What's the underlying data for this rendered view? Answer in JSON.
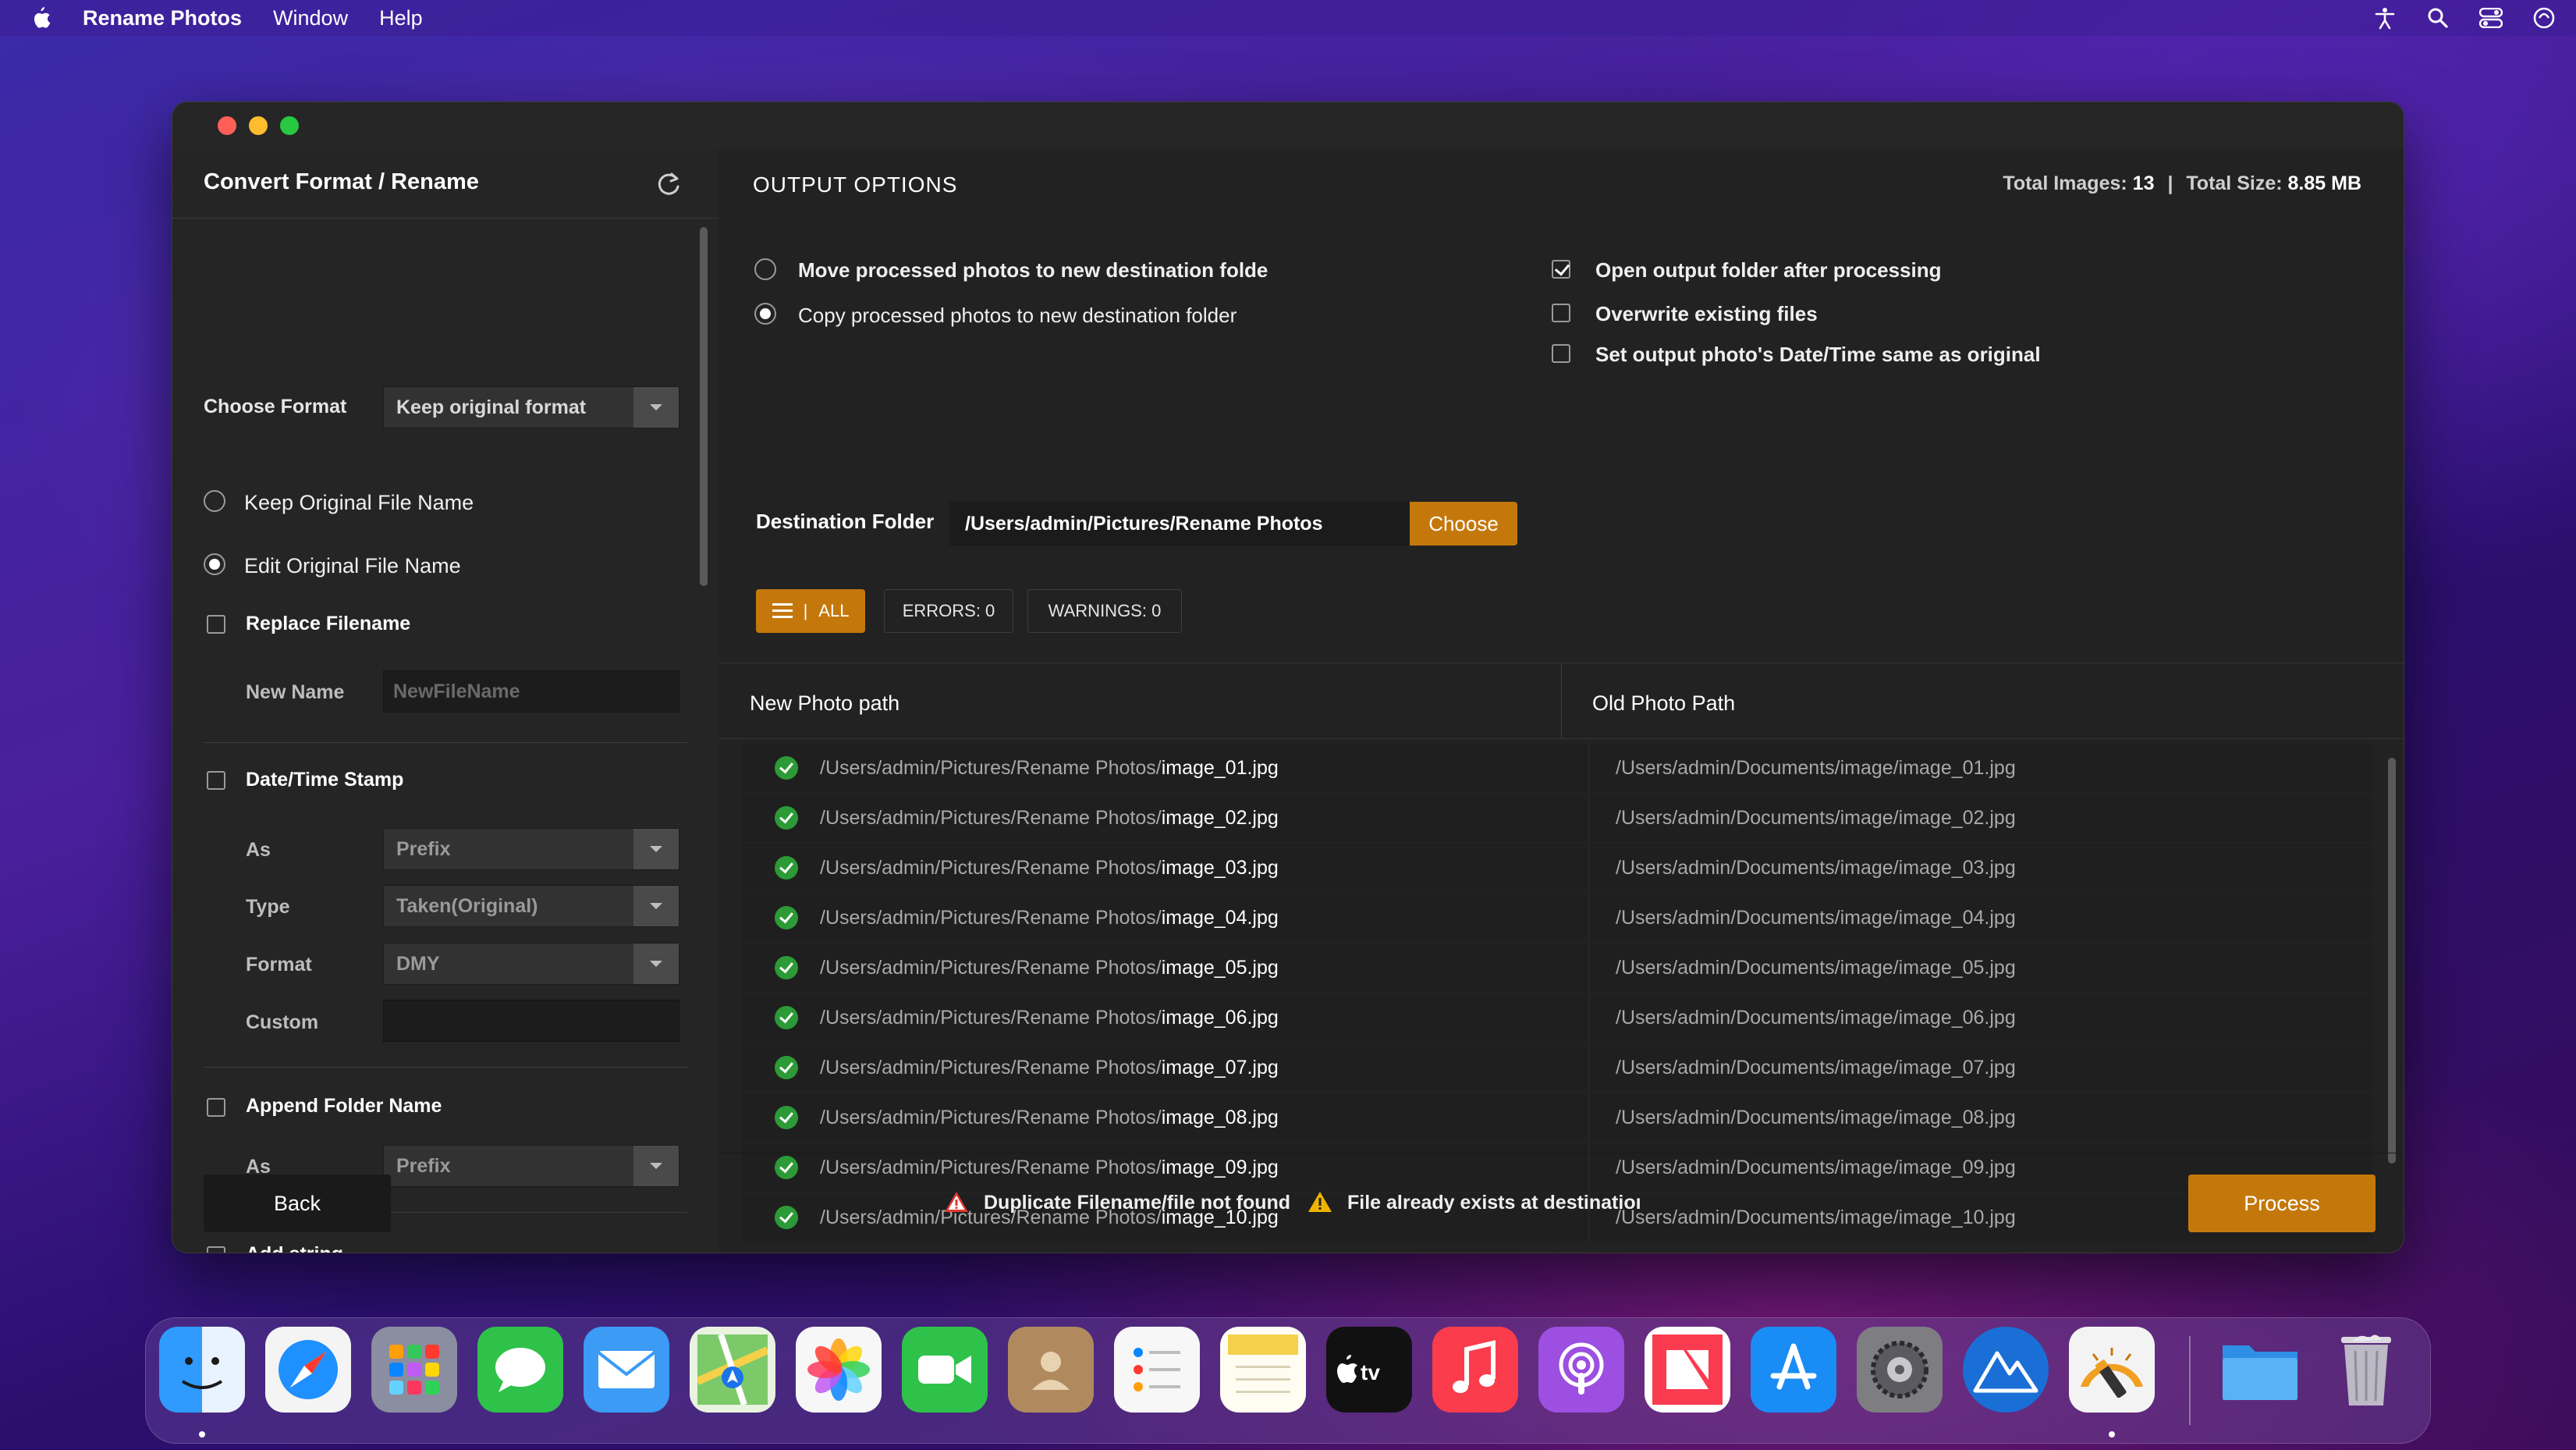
{
  "menubar": {
    "app_name": "Rename Photos",
    "menus": [
      "Window",
      "Help"
    ]
  },
  "sidebar": {
    "title": "Convert Format / Rename",
    "choose_format_label": "Choose Format",
    "choose_format_value": "Keep original format",
    "keep_original_label": "Keep Original File Name",
    "edit_original_label": "Edit Original File Name",
    "replace_filename_label": "Replace Filename",
    "new_name_label": "New Name",
    "new_name_placeholder": "NewFileName",
    "datetime_label": "Date/Time Stamp",
    "as_label": "As",
    "as_value": "Prefix",
    "type_label": "Type",
    "type_value": "Taken(Original)",
    "format_label": "Format",
    "format_value": "DMY",
    "custom_label": "Custom",
    "append_folder_label": "Append Folder Name",
    "append_as_label": "As",
    "append_as_value": "Prefix",
    "add_string_label": "Add string"
  },
  "output": {
    "title": "OUTPUT OPTIONS",
    "total_images_label": "Total Images:",
    "total_images": "13",
    "total_size_label": "Total Size:",
    "total_size": "8.85 MB",
    "move_label": "Move processed photos to new destination folde",
    "copy_label": "Copy processed photos to new destination folder",
    "open_output_label": "Open output folder after processing",
    "overwrite_label": "Overwrite existing files",
    "set_datetime_label": "Set output photo's Date/Time same as original",
    "destination_label": "Destination Folder",
    "destination_value": "/Users/admin/Pictures/Rename Photos",
    "choose_button": "Choose"
  },
  "filters": {
    "all": "ALL",
    "errors": "ERRORS: 0",
    "warnings": "WARNINGS: 0"
  },
  "table": {
    "col_new": "New Photo path",
    "col_old": "Old Photo Path",
    "new_prefix": "/Users/admin/Pictures/Rename Photos/",
    "rows": [
      {
        "new_file": "image_01.jpg",
        "old": "/Users/admin/Documents/image/image_01.jpg"
      },
      {
        "new_file": "image_02.jpg",
        "old": "/Users/admin/Documents/image/image_02.jpg"
      },
      {
        "new_file": "image_03.jpg",
        "old": "/Users/admin/Documents/image/image_03.jpg"
      },
      {
        "new_file": "image_04.jpg",
        "old": "/Users/admin/Documents/image/image_04.jpg"
      },
      {
        "new_file": "image_05.jpg",
        "old": "/Users/admin/Documents/image/image_05.jpg"
      },
      {
        "new_file": "image_06.jpg",
        "old": "/Users/admin/Documents/image/image_06.jpg"
      },
      {
        "new_file": "image_07.jpg",
        "old": "/Users/admin/Documents/image/image_07.jpg"
      },
      {
        "new_file": "image_08.jpg",
        "old": "/Users/admin/Documents/image/image_08.jpg"
      },
      {
        "new_file": "image_09.jpg",
        "old": "/Users/admin/Documents/image/image_09.jpg"
      },
      {
        "new_file": "image_10.jpg",
        "old": "/Users/admin/Documents/image/image_10.jpg"
      }
    ]
  },
  "footer": {
    "back": "Back",
    "process": "Process",
    "legend_duplicate": "Duplicate Filename/file not found",
    "legend_exists": "File already exists at destinatioı"
  },
  "colors": {
    "accent": "#c4780b",
    "success": "#2c9a36",
    "error": "#e0392f",
    "warning": "#f0b400"
  },
  "dock": [
    {
      "name": "finder",
      "color": "#2a8cf0"
    },
    {
      "name": "safari",
      "color": "#1e90ff"
    },
    {
      "name": "launchpad",
      "color": "#8a8ea0"
    },
    {
      "name": "messages",
      "color": "#2fc24a"
    },
    {
      "name": "mail",
      "color": "#3b9bf5"
    },
    {
      "name": "maps",
      "color": "#4cae5a"
    },
    {
      "name": "photos",
      "color": "#f2f2f2"
    },
    {
      "name": "facetime",
      "color": "#2fc24a"
    },
    {
      "name": "contacts",
      "color": "#b08a5e"
    },
    {
      "name": "reminders",
      "color": "#f7f7f7"
    },
    {
      "name": "notes",
      "color": "#f5d04a"
    },
    {
      "name": "apple-tv",
      "color": "#111111"
    },
    {
      "name": "music",
      "color": "#fa3c4c"
    },
    {
      "name": "podcasts",
      "color": "#9c4fe0"
    },
    {
      "name": "news",
      "color": "#fb3b50"
    },
    {
      "name": "app-store",
      "color": "#1a8cf5"
    },
    {
      "name": "system-preferences",
      "color": "#7d7d82"
    },
    {
      "name": "altitude-app",
      "color": "#1a6fd6"
    },
    {
      "name": "rename-photos",
      "color": "#f3f3f3"
    },
    {
      "name": "downloads-folder",
      "color": "#3aa0f0"
    },
    {
      "name": "trash",
      "color": "#c9c9cf"
    }
  ]
}
